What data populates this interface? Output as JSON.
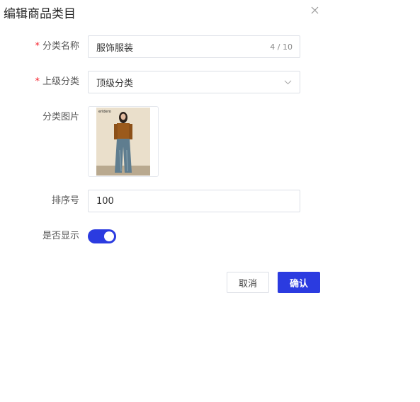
{
  "dialog": {
    "title": "编辑商品类目",
    "close_icon": "close-icon"
  },
  "form": {
    "name": {
      "label": "分类名称",
      "required": true,
      "value": "服饰服装",
      "counter": "4 / 10"
    },
    "parent": {
      "label": "上级分类",
      "required": true,
      "value": "顶级分类"
    },
    "image": {
      "label": "分类图片",
      "photo_caption": "eridero"
    },
    "sort": {
      "label": "排序号",
      "value": "100"
    },
    "visible": {
      "label": "是否显示",
      "on": true
    },
    "required_mark": "*"
  },
  "actions": {
    "cancel_label": "取消",
    "confirm_label": "确认"
  },
  "colors": {
    "primary": "#2b3be0",
    "required": "#f5222d"
  }
}
